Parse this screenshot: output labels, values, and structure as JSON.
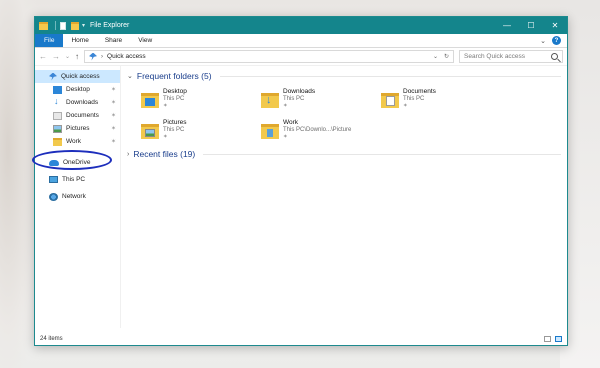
{
  "window": {
    "title": "File Explorer",
    "controls": [
      "—",
      "☐",
      "✕"
    ]
  },
  "ribbon": {
    "tabs": [
      "File",
      "Home",
      "Share",
      "View"
    ],
    "expand_icon": "⌄",
    "help_label": "?"
  },
  "address": {
    "back": "←",
    "forward": "→",
    "recent": "⌄",
    "up": "↑",
    "path_chevron": "›",
    "path": "Quick access",
    "dropdown": "⌄",
    "refresh": "↻",
    "search_placeholder": "Search Quick access"
  },
  "sidebar": {
    "quick_access": "Quick access",
    "pinned": [
      {
        "label": "Desktop",
        "icon": "desktop-icon"
      },
      {
        "label": "Downloads",
        "icon": "download-icon"
      },
      {
        "label": "Documents",
        "icon": "documents-icon"
      },
      {
        "label": "Pictures",
        "icon": "pictures-icon"
      },
      {
        "label": "Work",
        "icon": "folder-icon"
      }
    ],
    "onedrive": "OneDrive",
    "this_pc": "This PC",
    "network": "Network"
  },
  "main": {
    "frequent_header": "Frequent folders (5)",
    "recent_header": "Recent files (19)",
    "folders": [
      {
        "name": "Desktop",
        "location": "This PC"
      },
      {
        "name": "Downloads",
        "location": "This PC"
      },
      {
        "name": "Documents",
        "location": "This PC"
      },
      {
        "name": "Pictures",
        "location": "This PC"
      },
      {
        "name": "Work",
        "location": "This PC\\Downlo...\\Picture"
      }
    ]
  },
  "status": {
    "items": "24 items"
  },
  "colors": {
    "titlebar": "#14858c",
    "file_tab": "#1979ca",
    "selected": "#cce8ff",
    "annotation_ring": "#1d2ebc"
  }
}
